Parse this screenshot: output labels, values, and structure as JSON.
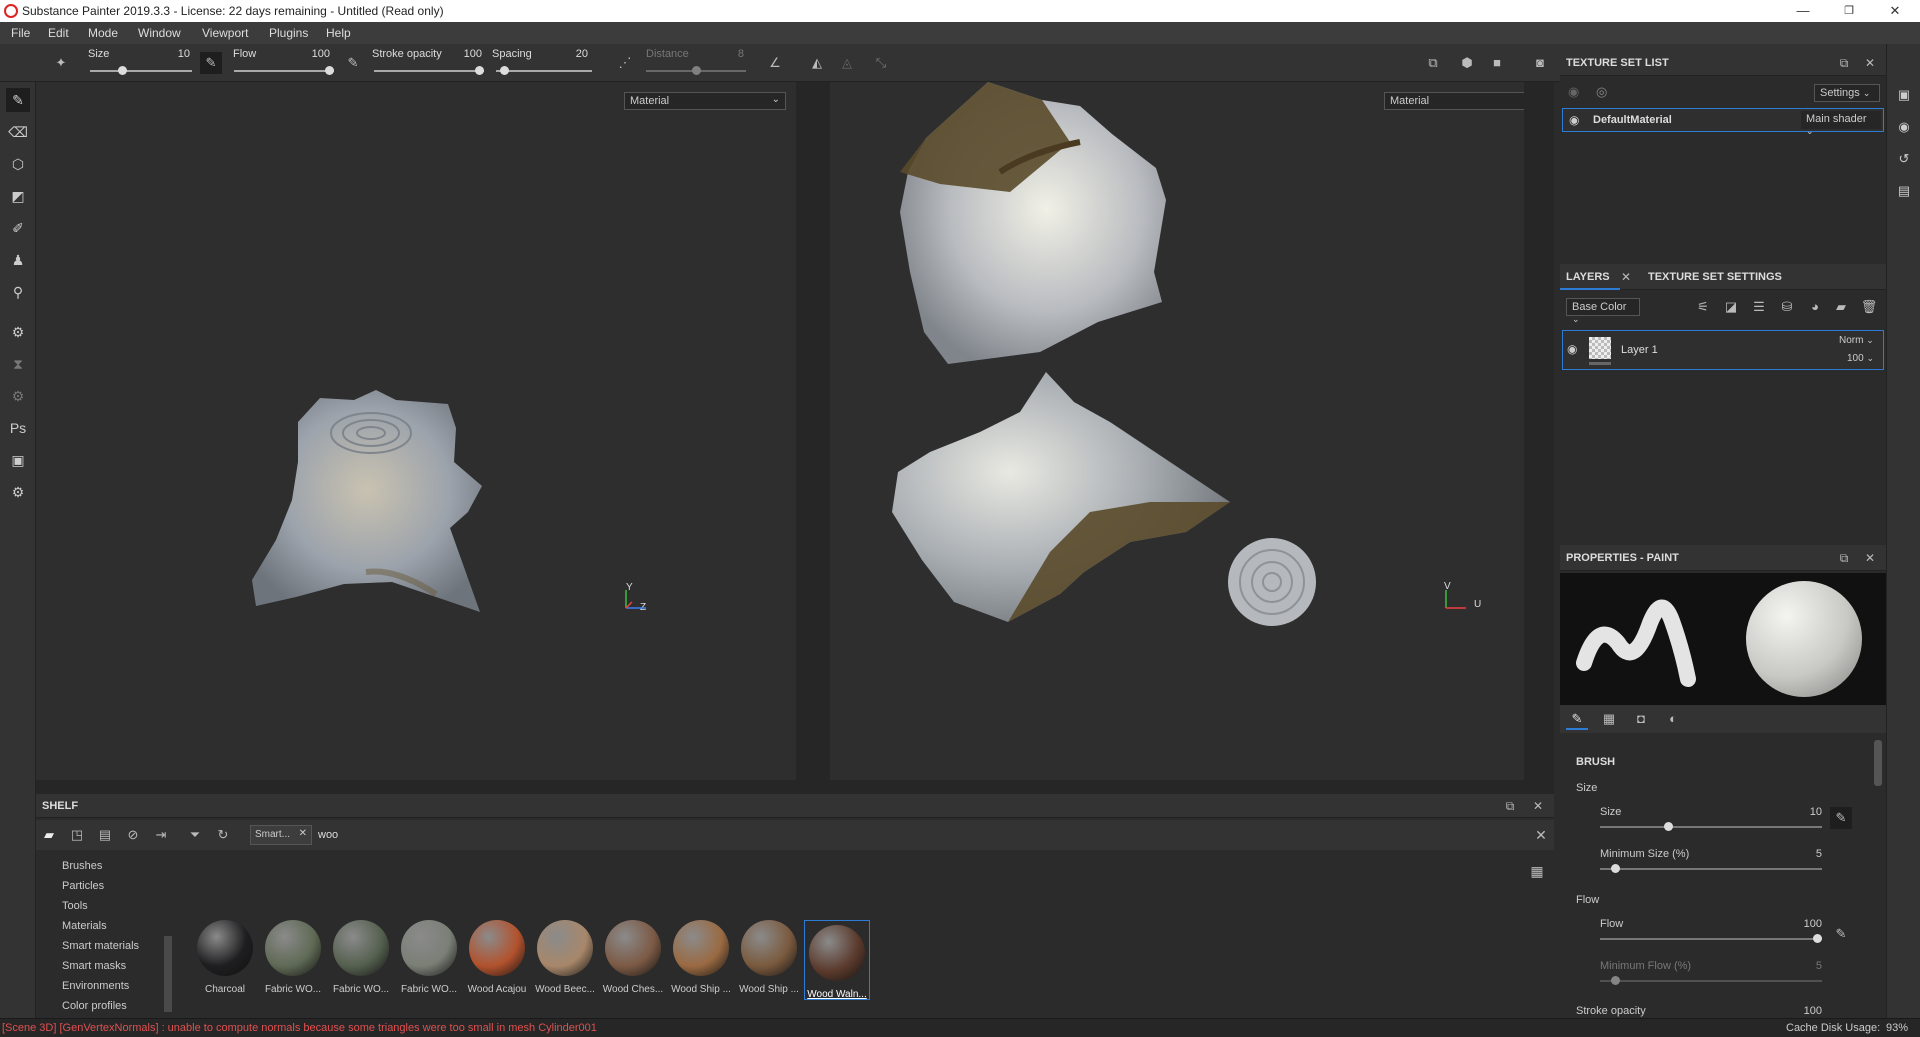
{
  "window": {
    "title": "Substance Painter 2019.3.3 - License: 22 days remaining - Untitled (Read only)",
    "min": "—",
    "max": "❐",
    "close": "✕"
  },
  "menu": [
    "File",
    "Edit",
    "Mode",
    "Window",
    "Viewport",
    "Plugins",
    "Help"
  ],
  "toolbar": {
    "size_label": "Size",
    "size_value": "10",
    "size_frac": 0.3,
    "flow_label": "Flow",
    "flow_value": "100",
    "flow_frac": 1.0,
    "opacity_label": "Stroke opacity",
    "opacity_value": "100",
    "opacity_frac": 1.0,
    "spacing_label": "Spacing",
    "spacing_value": "20",
    "spacing_frac": 0.05,
    "distance_label": "Distance",
    "distance_value": "8",
    "distance_frac": 0.5
  },
  "viewport_3d": {
    "mode": "Material",
    "axis_y": "Y",
    "axis_z": "Z"
  },
  "viewport_2d": {
    "mode": "Material",
    "axis_v": "V",
    "axis_u": "U"
  },
  "texture_set_list": {
    "title": "TEXTURE SET LIST",
    "settings_label": "Settings",
    "material_name": "DefaultMaterial",
    "shader": "Main shader"
  },
  "layers_panel": {
    "tab_layers": "LAYERS",
    "tab_texture_settings": "TEXTURE SET SETTINGS",
    "channel": "Base Color",
    "layer_name": "Layer 1",
    "blend_mode": "Norm",
    "opacity": "100"
  },
  "properties": {
    "title": "PROPERTIES - PAINT",
    "section_brush": "BRUSH",
    "group_size": "Size",
    "size_label": "Size",
    "size_value": "10",
    "size_frac": 0.3,
    "min_size_label": "Minimum Size (%)",
    "min_size_value": "5",
    "min_size_frac": 0.05,
    "group_flow": "Flow",
    "flow_label": "Flow",
    "flow_value": "100",
    "flow_frac": 1.0,
    "min_flow_label": "Minimum Flow (%)",
    "min_flow_value": "5",
    "min_flow_frac": 0.05,
    "stroke_opacity_label": "Stroke opacity",
    "stroke_opacity_value": "100"
  },
  "shelf": {
    "title": "SHELF",
    "filter_tag": "Smart...",
    "search_value": "woo",
    "categories": [
      "Brushes",
      "Particles",
      "Tools",
      "Materials",
      "Smart materials",
      "Smart masks",
      "Environments",
      "Color profiles"
    ],
    "materials": [
      {
        "name": "Charcoal",
        "color": "#1e1e20"
      },
      {
        "name": "Fabric WO...",
        "color": "#5f6a55"
      },
      {
        "name": "Fabric WO...",
        "color": "#55604f"
      },
      {
        "name": "Fabric WO...",
        "color": "#7a7f76"
      },
      {
        "name": "Wood Acajou",
        "color": "#b2522d"
      },
      {
        "name": "Wood Beec...",
        "color": "#a8876a"
      },
      {
        "name": "Wood Ches...",
        "color": "#7c5a45"
      },
      {
        "name": "Wood Ship ...",
        "color": "#9a6a42"
      },
      {
        "name": "Wood Ship ...",
        "color": "#7a5a3e"
      },
      {
        "name": "Wood Waln...",
        "color": "#5b3a2c"
      }
    ]
  },
  "status": {
    "message": "[Scene 3D] [GenVertexNormals] : unable to compute normals because some triangles were too small in mesh Cylinder001",
    "cache_label": "Cache Disk Usage:",
    "cache_value": "93%"
  },
  "colors": {
    "accent_blue": "#2e7bd6",
    "error_red": "#e05050"
  }
}
